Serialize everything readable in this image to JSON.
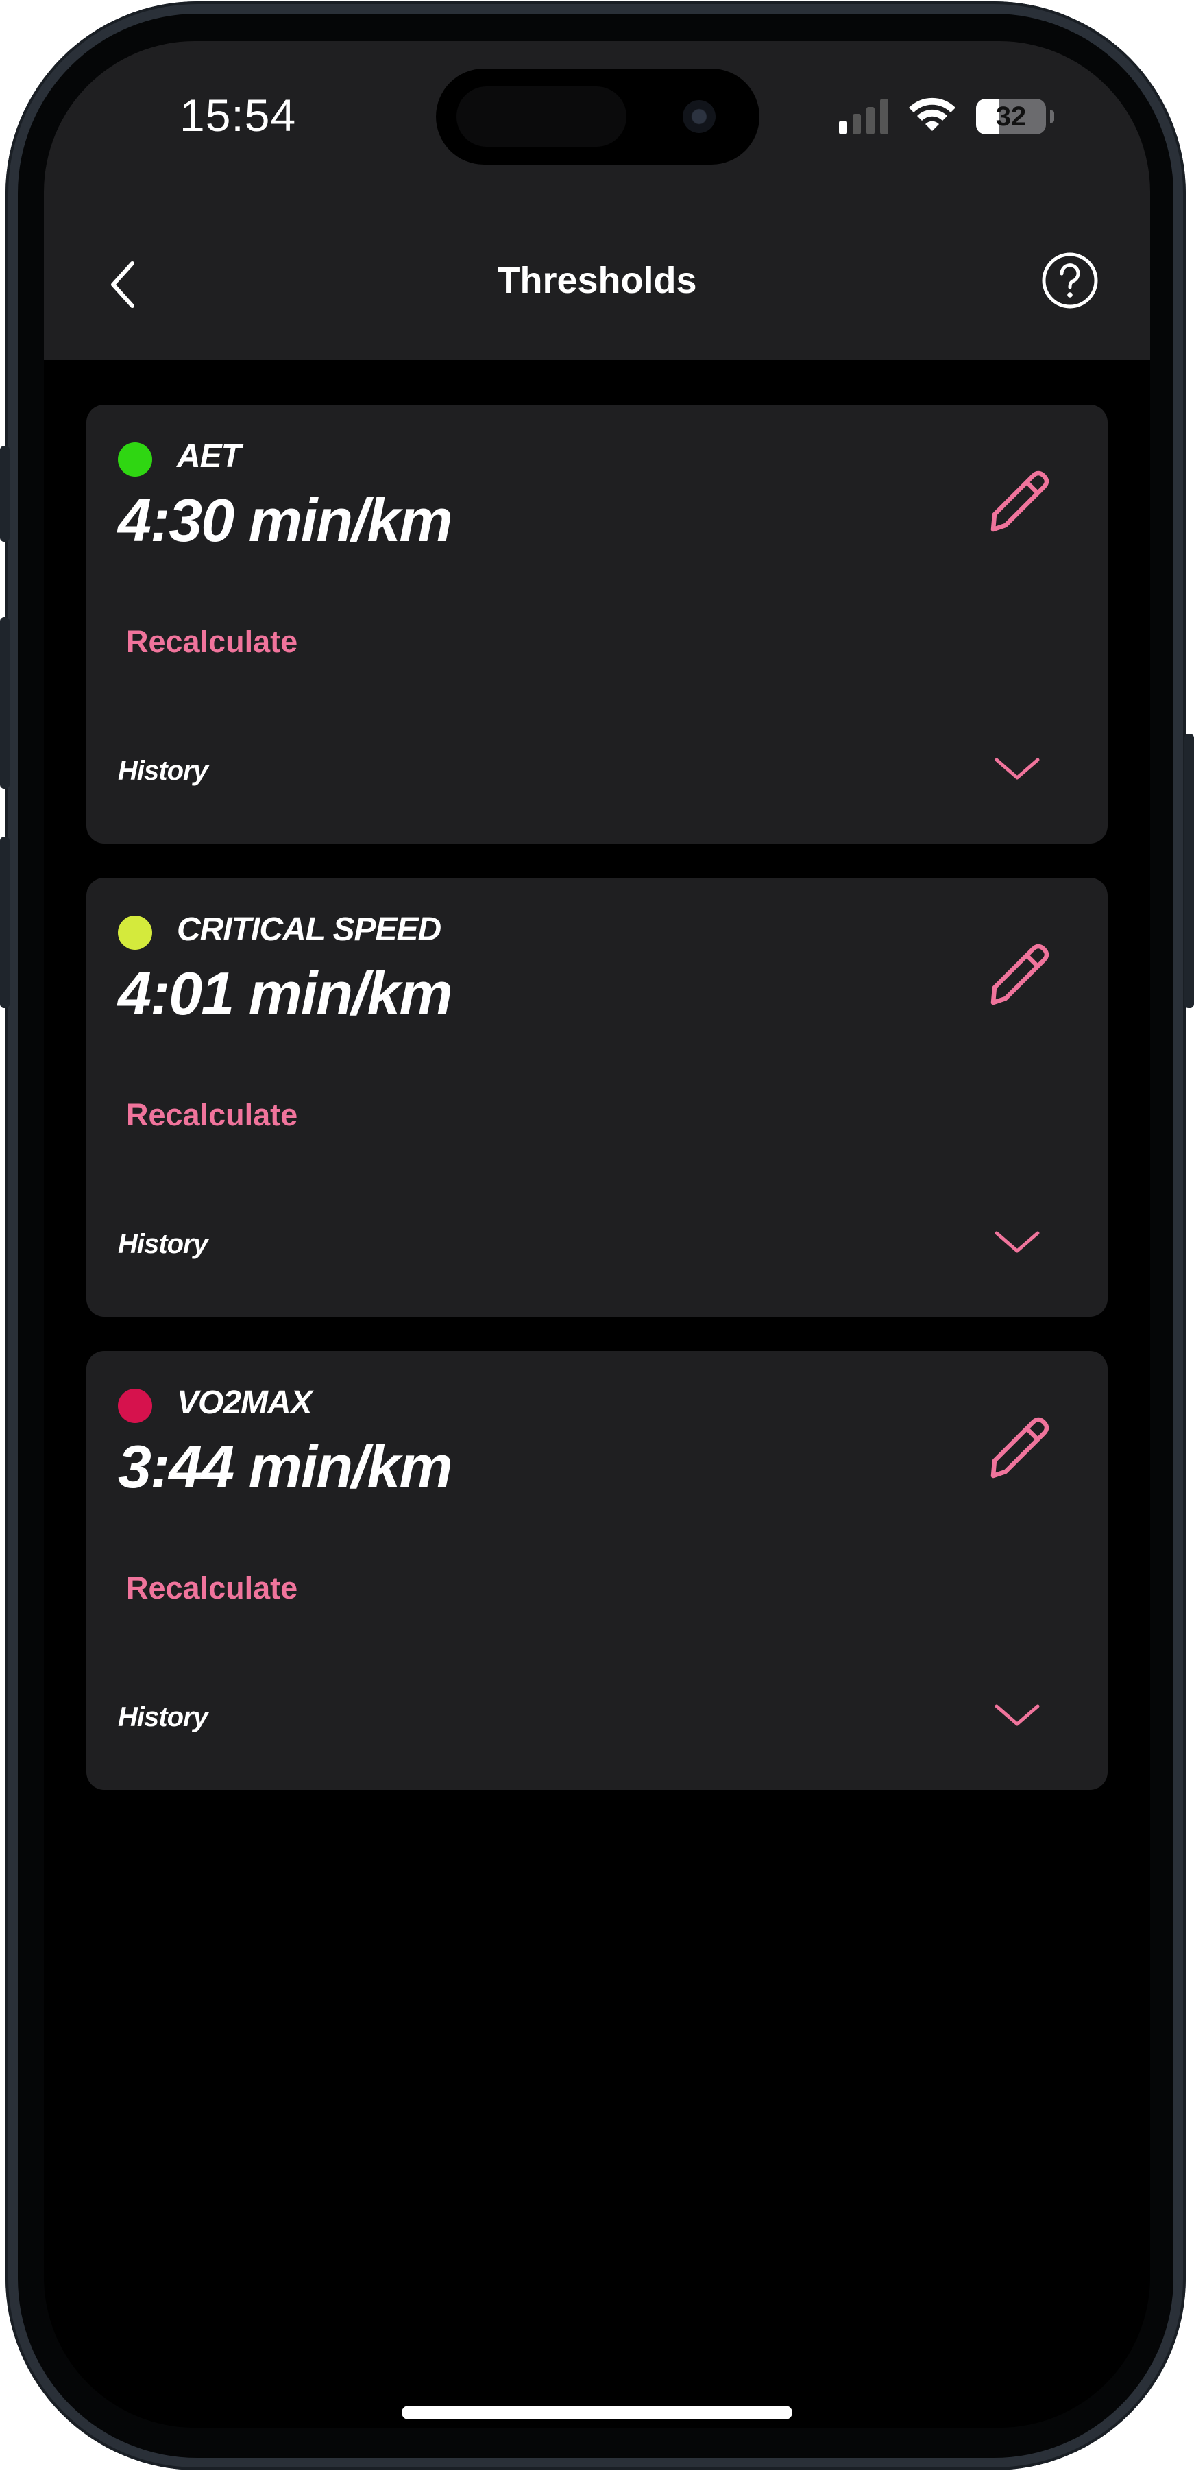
{
  "status_bar": {
    "time": "15:54",
    "battery_level": "32",
    "battery_fraction": 0.32,
    "signal_bars_active": 1,
    "signal_bars_total": 4
  },
  "header": {
    "title": "Thresholds",
    "back_icon": "chevron-left-icon",
    "help_icon": "question-circle-icon"
  },
  "thresholds": [
    {
      "name": "AET",
      "value": "4:30 min/km",
      "dot_color": "#2fd612",
      "recalculate_label": "Recalculate",
      "history_label": "History"
    },
    {
      "name": "CRITICAL SPEED",
      "value": "4:01 min/km",
      "dot_color": "#d4ea3c",
      "recalculate_label": "Recalculate",
      "history_label": "History"
    },
    {
      "name": "VO2MAX",
      "value": "3:44 min/km",
      "dot_color": "#d6124d",
      "recalculate_label": "Recalculate",
      "history_label": "History"
    }
  ],
  "colors": {
    "accent": "#f0749c",
    "card_bg": "#1f1f21",
    "screen_bg": "#000000"
  }
}
